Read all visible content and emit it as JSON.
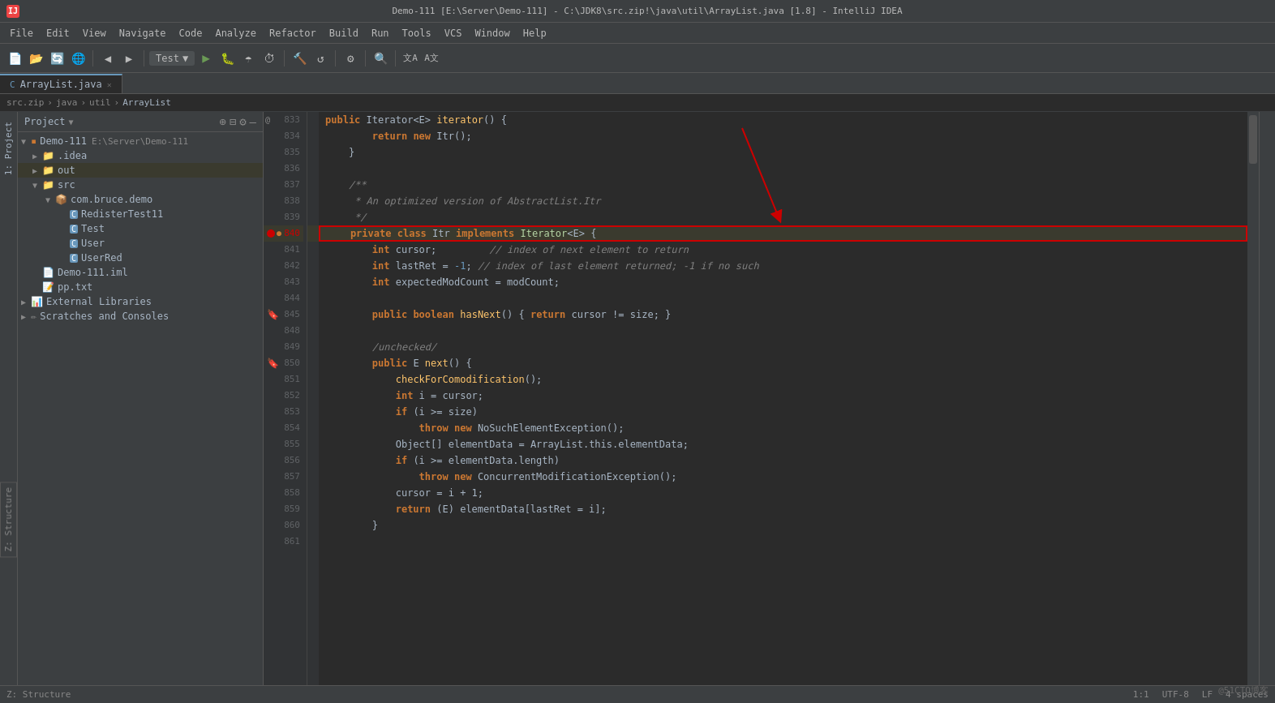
{
  "titlebar": {
    "title": "Demo-111 [E:\\Server\\Demo-111] - C:\\JDK8\\src.zip!\\java\\util\\ArrayList.java [1.8] - IntelliJ IDEA"
  },
  "menubar": {
    "items": [
      "File",
      "Edit",
      "View",
      "Navigate",
      "Code",
      "Analyze",
      "Refactor",
      "Build",
      "Run",
      "Tools",
      "VCS",
      "Window",
      "Help"
    ]
  },
  "toolbar": {
    "run_config": "Test",
    "buttons": [
      "new",
      "open",
      "sync",
      "browser",
      "back",
      "forward",
      "run-config",
      "run",
      "debug",
      "coverage",
      "profile",
      "build",
      "rebuild",
      "settings",
      "search",
      "translate1",
      "translate2"
    ]
  },
  "breadcrumb": {
    "parts": [
      "src.zip",
      "java",
      "util",
      "ArrayList"
    ]
  },
  "tabs": [
    {
      "label": "ArrayList.java",
      "active": true,
      "icon": "java"
    }
  ],
  "left_panel": {
    "title": "Project",
    "tree": [
      {
        "indent": 0,
        "type": "module",
        "label": "Demo-111",
        "extra": "E:\\Server\\Demo-111",
        "expanded": true
      },
      {
        "indent": 1,
        "type": "folder",
        "label": ".idea",
        "expanded": false
      },
      {
        "indent": 1,
        "type": "folder",
        "label": "out",
        "expanded": false
      },
      {
        "indent": 1,
        "type": "folder",
        "label": "src",
        "expanded": true
      },
      {
        "indent": 2,
        "type": "package",
        "label": "com.bruce.demo",
        "expanded": true
      },
      {
        "indent": 3,
        "type": "java",
        "label": "RedisterTest11"
      },
      {
        "indent": 3,
        "type": "java",
        "label": "Test"
      },
      {
        "indent": 3,
        "type": "java",
        "label": "User"
      },
      {
        "indent": 3,
        "type": "java",
        "label": "UserRed"
      },
      {
        "indent": 1,
        "type": "iml",
        "label": "Demo-111.iml"
      },
      {
        "indent": 1,
        "type": "txt",
        "label": "pp.txt"
      },
      {
        "indent": 0,
        "type": "libraries",
        "label": "External Libraries",
        "expanded": false
      },
      {
        "indent": 0,
        "type": "scratches",
        "label": "Scratches and Consoles",
        "expanded": false
      }
    ]
  },
  "code": {
    "lines": [
      {
        "num": 833,
        "content": "    public Iterator<E> iterator() {",
        "tokens": [
          {
            "t": "kw",
            "v": "public"
          },
          {
            "t": "",
            "v": " "
          },
          {
            "t": "type",
            "v": "Iterator"
          },
          {
            "t": "",
            "v": "<E> "
          },
          {
            "t": "method",
            "v": "iterator"
          },
          {
            "t": "",
            "v": "() {"
          }
        ]
      },
      {
        "num": 834,
        "content": "        return new Itr();",
        "tokens": [
          {
            "t": "kw",
            "v": "return"
          },
          {
            "t": "",
            "v": " "
          },
          {
            "t": "kw",
            "v": "new"
          },
          {
            "t": "",
            "v": " "
          },
          {
            "t": "class-name",
            "v": "Itr"
          },
          {
            "t": "",
            "v": "();"
          }
        ]
      },
      {
        "num": 835,
        "content": "    }",
        "tokens": [
          {
            "t": "",
            "v": "    }"
          }
        ]
      },
      {
        "num": 836,
        "content": "",
        "tokens": []
      },
      {
        "num": 837,
        "content": "    /**",
        "tokens": [
          {
            "t": "comment",
            "v": "    /**"
          }
        ]
      },
      {
        "num": 838,
        "content": "     * An optimized version of AbstractList.Itr",
        "tokens": [
          {
            "t": "comment",
            "v": "     * An optimized version of AbstractList.Itr"
          }
        ]
      },
      {
        "num": 839,
        "content": "     */",
        "tokens": [
          {
            "t": "comment",
            "v": "     */"
          }
        ]
      },
      {
        "num": 840,
        "content": "    private class Itr implements Iterator<E> {",
        "highlighted": true,
        "tokens": [
          {
            "t": "kw",
            "v": "    private"
          },
          {
            "t": "",
            "v": " "
          },
          {
            "t": "kw",
            "v": "class"
          },
          {
            "t": "",
            "v": " "
          },
          {
            "t": "class-name",
            "v": "Itr"
          },
          {
            "t": "",
            "v": " "
          },
          {
            "t": "kw",
            "v": "implements"
          },
          {
            "t": "",
            "v": " "
          },
          {
            "t": "interface",
            "v": "Iterator"
          },
          {
            "t": "",
            "v": "<E> {"
          }
        ]
      },
      {
        "num": 841,
        "content": "        int cursor;         // index of next element to return",
        "tokens": [
          {
            "t": "kw",
            "v": "        int"
          },
          {
            "t": "",
            "v": " "
          },
          {
            "t": "var",
            "v": "cursor"
          },
          {
            "t": "",
            "v": ";         "
          },
          {
            "t": "comment",
            "v": "// index of next element to return"
          }
        ]
      },
      {
        "num": 842,
        "content": "        int lastRet = -1; // index of last element returned; -1 if no such",
        "tokens": [
          {
            "t": "kw",
            "v": "        int"
          },
          {
            "t": "",
            "v": " "
          },
          {
            "t": "var",
            "v": "lastRet"
          },
          {
            "t": "",
            "v": " = "
          },
          {
            "t": "number",
            "v": "-1"
          },
          {
            "t": "",
            "v": "; "
          },
          {
            "t": "comment",
            "v": "// index of last element returned; -1 if no such"
          }
        ]
      },
      {
        "num": 843,
        "content": "        int expectedModCount = modCount;",
        "tokens": [
          {
            "t": "kw",
            "v": "        int"
          },
          {
            "t": "",
            "v": " "
          },
          {
            "t": "var",
            "v": "expectedModCount"
          },
          {
            "t": "",
            "v": " = "
          },
          {
            "t": "var",
            "v": "modCount"
          },
          {
            "t": "",
            "v": ";"
          }
        ]
      },
      {
        "num": 844,
        "content": "",
        "tokens": []
      },
      {
        "num": 845,
        "content": "        public boolean hasNext() { return cursor != size; }",
        "tokens": [
          {
            "t": "kw",
            "v": "        public"
          },
          {
            "t": "",
            "v": " "
          },
          {
            "t": "kw",
            "v": "boolean"
          },
          {
            "t": "",
            "v": " "
          },
          {
            "t": "method",
            "v": "hasNext"
          },
          {
            "t": "",
            "v": "() { "
          },
          {
            "t": "kw",
            "v": "return"
          },
          {
            "t": "",
            "v": " cursor != size; }"
          }
        ]
      },
      {
        "num": 848,
        "content": "",
        "tokens": []
      },
      {
        "num": 849,
        "content": "        /unchecked/",
        "tokens": [
          {
            "t": "comment",
            "v": "        /unchecked/"
          }
        ]
      },
      {
        "num": 850,
        "content": "        public E next() {",
        "tokens": [
          {
            "t": "kw",
            "v": "        public"
          },
          {
            "t": "",
            "v": " E "
          },
          {
            "t": "method",
            "v": "next"
          },
          {
            "t": "",
            "v": "() {"
          }
        ]
      },
      {
        "num": 851,
        "content": "            checkForComodification();",
        "tokens": [
          {
            "t": "",
            "v": "            "
          },
          {
            "t": "method",
            "v": "checkForComodification"
          },
          {
            "t": "",
            "v": "();"
          }
        ]
      },
      {
        "num": 852,
        "content": "            int i = cursor;",
        "tokens": [
          {
            "t": "kw",
            "v": "            int"
          },
          {
            "t": "",
            "v": " i = cursor;"
          }
        ]
      },
      {
        "num": 853,
        "content": "            if (i >= size)",
        "tokens": [
          {
            "t": "kw",
            "v": "            if"
          },
          {
            "t": "",
            "v": " (i >= size)"
          }
        ]
      },
      {
        "num": 854,
        "content": "                throw new NoSuchElementException();",
        "tokens": [
          {
            "t": "kw",
            "v": "                throw"
          },
          {
            "t": "",
            "v": " "
          },
          {
            "t": "kw",
            "v": "new"
          },
          {
            "t": "",
            "v": " "
          },
          {
            "t": "class-name",
            "v": "NoSuchElementException"
          },
          {
            "t": "",
            "v": "();"
          }
        ]
      },
      {
        "num": 855,
        "content": "            Object[] elementData = ArrayList.this.elementData;",
        "tokens": [
          {
            "t": "kw",
            "v": "            Object"
          },
          {
            "t": "",
            "v": "[] elementData = "
          },
          {
            "t": "class-name",
            "v": "ArrayList"
          },
          {
            "t": "",
            "v": ".this.elementData;"
          }
        ]
      },
      {
        "num": 856,
        "content": "            if (i >= elementData.length)",
        "tokens": [
          {
            "t": "kw",
            "v": "            if"
          },
          {
            "t": "",
            "v": " (i >= elementData.length)"
          }
        ]
      },
      {
        "num": 857,
        "content": "                throw new ConcurrentModificationException();",
        "tokens": [
          {
            "t": "kw",
            "v": "                throw"
          },
          {
            "t": "",
            "v": " "
          },
          {
            "t": "kw",
            "v": "new"
          },
          {
            "t": "",
            "v": " "
          },
          {
            "t": "class-name",
            "v": "ConcurrentModificationException"
          },
          {
            "t": "",
            "v": "();"
          }
        ]
      },
      {
        "num": 858,
        "content": "            cursor = i + 1;",
        "tokens": [
          {
            "t": "",
            "v": "            cursor = i + 1;"
          }
        ]
      },
      {
        "num": 859,
        "content": "            return (E) elementData[lastRet = i];",
        "tokens": [
          {
            "t": "kw",
            "v": "            return"
          },
          {
            "t": "",
            "v": " (E) elementData[lastRet = i];"
          }
        ]
      },
      {
        "num": 860,
        "content": "        }",
        "tokens": [
          {
            "t": "",
            "v": "        }"
          }
        ]
      },
      {
        "num": 861,
        "content": "",
        "tokens": []
      }
    ]
  },
  "bottom_bar": {
    "status": "1:1",
    "encoding": "UTF-8",
    "line_sep": "LF",
    "indent": "4 spaces"
  },
  "watermark": "@51CTO博客"
}
